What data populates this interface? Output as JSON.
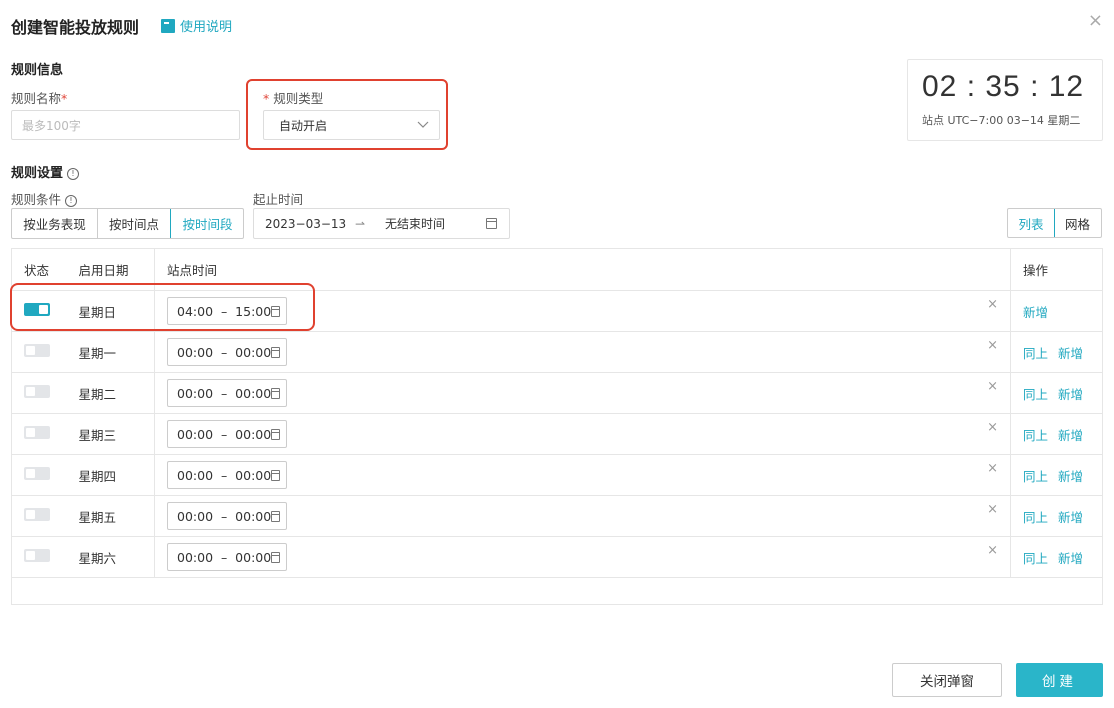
{
  "header": {
    "title": "创建智能投放规则",
    "help_label": "使用说明",
    "close": "×"
  },
  "rule_info": {
    "section_title": "规则信息",
    "name_label": "规则名称",
    "required_mark": "*",
    "name_placeholder": "最多100字",
    "type_label": "规则类型",
    "type_value": "自动开启"
  },
  "clock": {
    "time": "02 : 35 : 12",
    "subtitle": "站点 UTC−7:00  03−14 星期二"
  },
  "rule_settings": {
    "section_title": "规则设置",
    "condition_label": "规则条件",
    "condition_options": [
      "按业务表现",
      "按时间点",
      "按时间段"
    ],
    "condition_selected": "按时间段",
    "period_label": "起止时间",
    "start_date": "2023−03−13",
    "arrow": "⇀",
    "end_date": "无结束时间",
    "view_options": [
      "列表",
      "网格"
    ],
    "view_selected": "列表"
  },
  "table": {
    "headers": {
      "status": "状态",
      "date": "启用日期",
      "time": "站点时间",
      "ops": "操作"
    },
    "rows": [
      {
        "enabled": true,
        "day": "星期日",
        "time": "04:00  –  15:00",
        "ops": [
          "新增"
        ]
      },
      {
        "enabled": false,
        "day": "星期一",
        "time": "00:00  –  00:00",
        "ops": [
          "同上",
          "新增"
        ]
      },
      {
        "enabled": false,
        "day": "星期二",
        "time": "00:00  –  00:00",
        "ops": [
          "同上",
          "新增"
        ]
      },
      {
        "enabled": false,
        "day": "星期三",
        "time": "00:00  –  00:00",
        "ops": [
          "同上",
          "新增"
        ]
      },
      {
        "enabled": false,
        "day": "星期四",
        "time": "00:00  –  00:00",
        "ops": [
          "同上",
          "新增"
        ]
      },
      {
        "enabled": false,
        "day": "星期五",
        "time": "00:00  –  00:00",
        "ops": [
          "同上",
          "新增"
        ]
      },
      {
        "enabled": false,
        "day": "星期六",
        "time": "00:00  –  00:00",
        "ops": [
          "同上",
          "新增"
        ]
      }
    ]
  },
  "footer": {
    "close_label": "关闭弹窗",
    "create_label": "创建"
  },
  "colors": {
    "accent": "#20a8c0",
    "highlight": "#e0412f",
    "primary_button": "#2ab5c9"
  }
}
